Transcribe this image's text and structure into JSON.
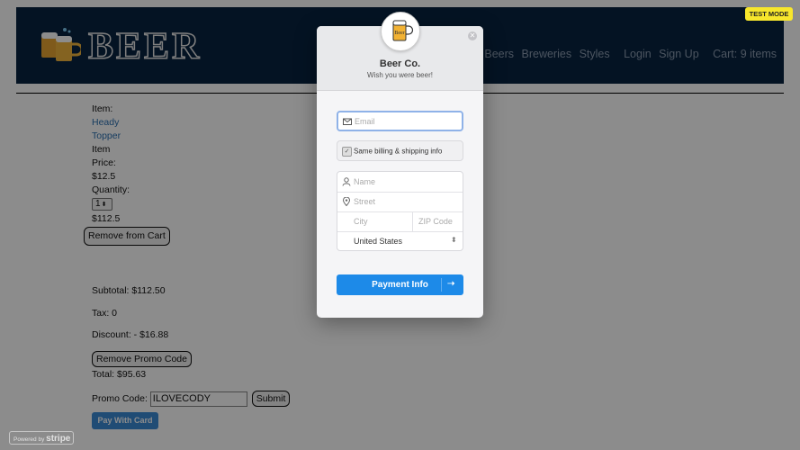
{
  "header": {
    "logo_text": "BEER",
    "nav": [
      "Beers",
      "Breweries",
      "Styles",
      "Login",
      "Sign Up",
      "Cart: 9 items"
    ]
  },
  "cart": {
    "item_label": "Item:",
    "item_name_1": "Heady",
    "item_name_2": "Topper",
    "item_word": "Item",
    "price_label": "Price:",
    "price": "$12.5",
    "quantity_label": "Quantity:",
    "quantity": "1",
    "line_total": "$112.5",
    "remove_label": "Remove from Cart"
  },
  "summary": {
    "subtotal": "Subtotal: $112.50",
    "tax": "Tax: 0",
    "discount": "Discount: - $16.88",
    "remove_promo": "Remove Promo Code",
    "total": "Total: $95.63",
    "promo_label": "Promo Code:",
    "promo_value": "ILOVECODY",
    "submit": "Submit",
    "pay_with_card": "Pay With Card"
  },
  "stripe": {
    "test_mode": "TEST MODE",
    "powered_by": "Powered by",
    "stripe_word": "stripe",
    "title": "Beer Co.",
    "subtitle": "Wish you were beer!",
    "email_placeholder": "Email",
    "same_billing": "Same billing & shipping info",
    "name_placeholder": "Name",
    "street_placeholder": "Street",
    "city_placeholder": "City",
    "zip_placeholder": "ZIP Code",
    "country": "United States",
    "pay_button": "Payment Info"
  },
  "colors": {
    "header_bg": "#092340",
    "stripe_blue": "#1d8ae8",
    "test_mode_yellow": "#f7e62c"
  }
}
